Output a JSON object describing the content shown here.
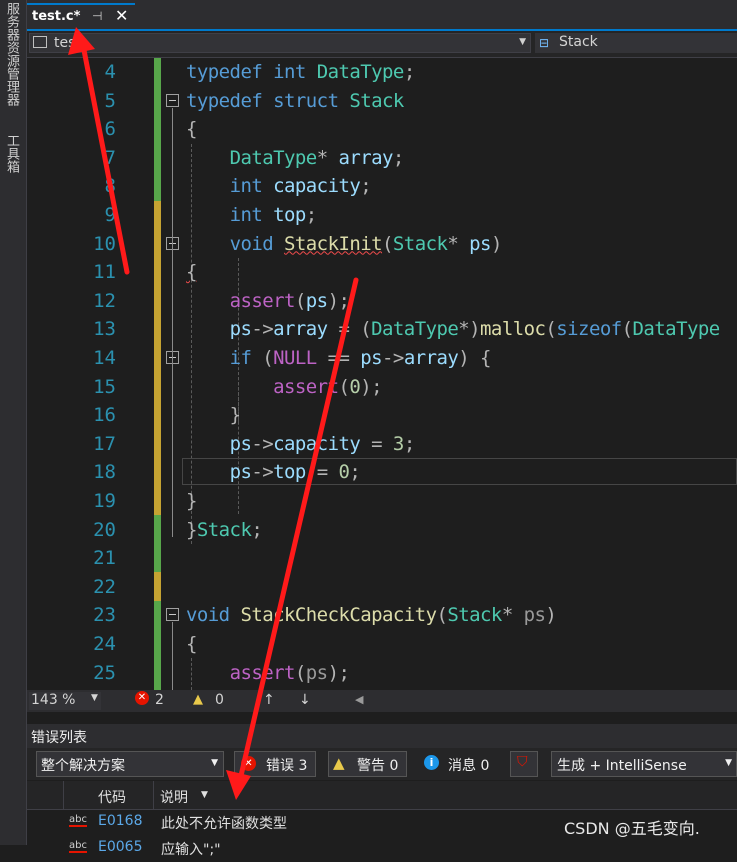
{
  "side_panel": {
    "labels": [
      "服务器资源管理器",
      "工具箱"
    ]
  },
  "tab": {
    "title": "test.c*",
    "pin_glyph": "⊣",
    "close_glyph": "✕"
  },
  "nav": {
    "left_value": "tes",
    "right_value": "Stack"
  },
  "editor": {
    "line_numbers": [
      "4",
      "5",
      "6",
      "7",
      "8",
      "9",
      "10",
      "11",
      "12",
      "13",
      "14",
      "15",
      "16",
      "17",
      "18",
      "19",
      "20",
      "21",
      "22",
      "23",
      "24",
      "25"
    ]
  },
  "status": {
    "zoom": "143 %",
    "errors": "2",
    "warnings": "0"
  },
  "error_list": {
    "title": "错误列表",
    "scope": "整个解决方案",
    "errors_btn": "错误 3",
    "warnings_btn": "警告 0",
    "messages_btn": "消息 0",
    "build_filter": "生成 + IntelliSense",
    "col_code": "代码",
    "col_desc": "说明",
    "rows": [
      {
        "code": "E0168",
        "desc": "此处不允许函数类型"
      },
      {
        "code": "E0065",
        "desc": "应输入\";\""
      }
    ]
  },
  "watermark": "CSDN @五毛变向.",
  "colors": {
    "accent": "#007acc",
    "annotation_arrow": "#ff1a1a",
    "change_saved": "#57a64a",
    "change_unsaved": "#c5a332"
  }
}
